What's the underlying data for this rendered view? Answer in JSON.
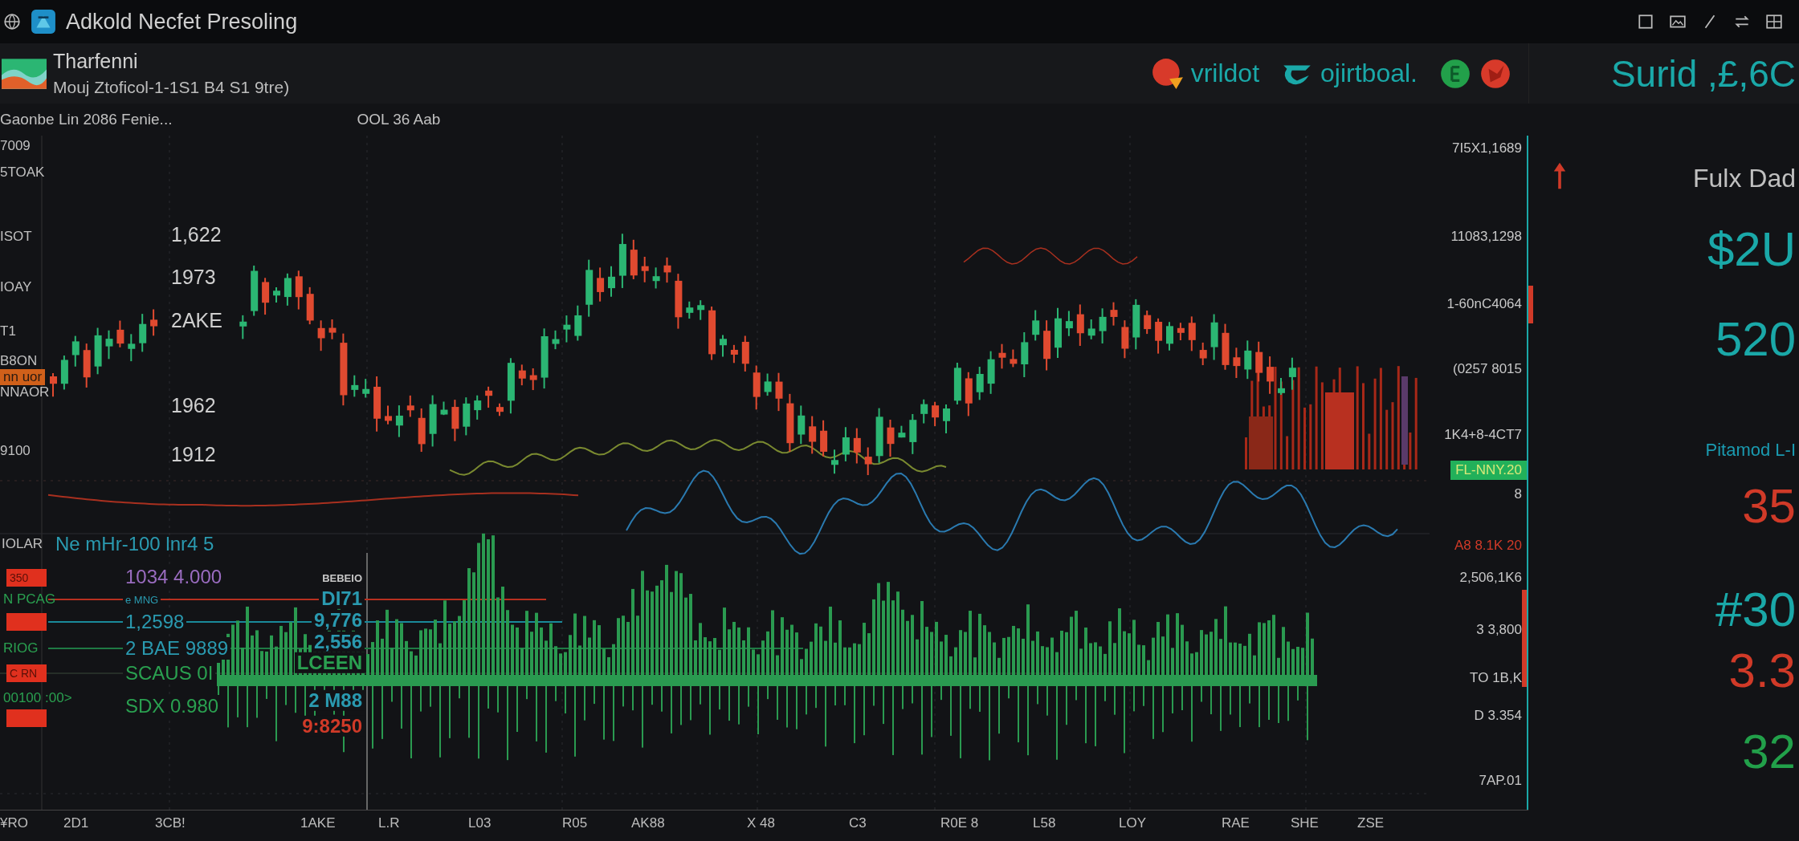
{
  "window": {
    "title": "Adkold Necfet Presoling"
  },
  "header": {
    "instrument": "Tharfenni",
    "subtitle": "Mouj Ztoficol-1-1S1 B4 S1 9tre)",
    "brands": [
      {
        "kind": "pin",
        "label": "vrildot"
      },
      {
        "kind": "wave",
        "label": "ojirtboal."
      }
    ],
    "ticker": "Surid ,£,6C"
  },
  "info_bar": {
    "left": "Gaonbe Lin 2086 Fenie...",
    "right": "OOL 36 Aab"
  },
  "left_axis": [
    {
      "kind": "plain",
      "label": "7009"
    },
    {
      "kind": "plain",
      "label": "5TOAK"
    },
    {
      "kind": "plain",
      "label": "ISOT"
    },
    {
      "kind": "plain",
      "label": "IOAY"
    },
    {
      "kind": "plain",
      "label": "T1"
    },
    {
      "kind": "plain",
      "label": "B8ON"
    },
    {
      "kind": "badge",
      "label": "nn uor"
    },
    {
      "kind": "plain",
      "label": "NNAOR"
    },
    {
      "kind": "plain",
      "label": "9100"
    }
  ],
  "price_labels": [
    "1,622",
    "1973",
    "2AKE",
    "1962",
    "1912"
  ],
  "indicator": {
    "left": "IOLAR",
    "title": "Ne mHr-100 lnr4 5"
  },
  "lower_left": [
    {
      "kind": "badge",
      "label": "350"
    },
    {
      "kind": "text",
      "label": "N PCAG"
    },
    {
      "kind": "badge"
    },
    {
      "kind": "text",
      "label": "RIOG"
    },
    {
      "kind": "badge",
      "label": "C RN"
    },
    {
      "kind": "text",
      "label": "00100 :00>"
    },
    {
      "kind": "badge"
    }
  ],
  "lower_values": [
    {
      "label": "1034 4.000",
      "color": "#9a6cc0"
    },
    {
      "label": "e MNG",
      "color": "#2a9ab0"
    },
    {
      "label": "1,2598",
      "color": "#2a9ab0"
    },
    {
      "label": "2 BAE 9889",
      "color": "#2a9ab0"
    },
    {
      "label": "SCAUS 0I",
      "color": "#2aa050"
    },
    {
      "label": "SDX 0.980",
      "color": "#2aa050"
    }
  ],
  "lower_right_values": [
    {
      "label": "BEBEIO",
      "color": "#c8c8c8"
    },
    {
      "label": "DI71",
      "color": "#2a9ab0"
    },
    {
      "label": "9,776",
      "color": "#2a9ab0"
    },
    {
      "label": "2,556",
      "color": "#2a9ab0"
    },
    {
      "label": "LCEEN",
      "color": "#2aa050"
    },
    {
      "label": "2 M88",
      "color": "#2a9ab0"
    },
    {
      "label": "9:8250",
      "color": "#d03a28"
    }
  ],
  "price_axis": [
    {
      "kind": "plain",
      "label": "7I5X1,1689"
    },
    {
      "kind": "plain",
      "label": "11083,1298"
    },
    {
      "kind": "plain",
      "label": "1-60nC4064"
    },
    {
      "kind": "plain",
      "label": "(0257 8015"
    },
    {
      "kind": "plain",
      "label": "1K4+8-4CT7"
    },
    {
      "kind": "badge",
      "label": "FL-NNY.20"
    },
    {
      "kind": "plain",
      "label": "8"
    },
    {
      "kind": "down",
      "label": "A8 8.1K 20"
    },
    {
      "kind": "plain",
      "label": "2,506,1K6"
    },
    {
      "kind": "plain",
      "label": "3 3,800"
    },
    {
      "kind": "plain",
      "label": "TO 1B,K"
    },
    {
      "kind": "plain",
      "label": "D 3.354"
    },
    {
      "kind": "plain",
      "label": "7AP.01"
    }
  ],
  "side_panel": [
    {
      "kind": "caption",
      "label": "Fulx Dad"
    },
    {
      "kind": "big",
      "label": "$2U",
      "color": "#1aa8a8"
    },
    {
      "kind": "big",
      "label": "520",
      "color": "#1aa8a8"
    },
    {
      "kind": "small",
      "label": "Pitamod L-I",
      "color": "#1a9ab0"
    },
    {
      "kind": "big",
      "label": "35",
      "color": "#d03a28"
    },
    {
      "kind": "big",
      "label": "#30",
      "color": "#1aa8a8"
    },
    {
      "kind": "big",
      "label": "3.3",
      "color": "#d03a28"
    },
    {
      "kind": "big",
      "label": "32",
      "color": "#22a04a"
    }
  ],
  "time_axis": [
    "¥RO",
    "2D1",
    "3CB!",
    "1AKE",
    "L.R",
    "L03",
    "R05",
    "AK88",
    "X 48",
    "C3",
    "R0E 8",
    "L58",
    "LOY",
    "RAE",
    "SHE",
    "ZSE"
  ]
}
